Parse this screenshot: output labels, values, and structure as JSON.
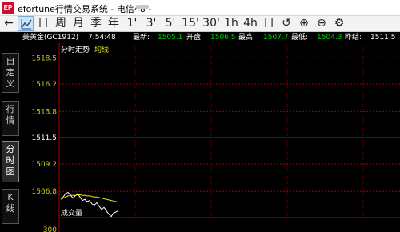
{
  "window": {
    "logo_text": "EP",
    "title": "efortune行情交易系统 - 电信48 -"
  },
  "toolbar": {
    "buttons": [
      {
        "label": "←",
        "icon": "back-arrow-icon"
      },
      {
        "label": "",
        "icon": "trend-line-icon",
        "selected": true
      },
      {
        "label": "日"
      },
      {
        "label": "周"
      },
      {
        "label": "月"
      },
      {
        "label": "季"
      },
      {
        "label": "年"
      },
      {
        "label": "1'"
      },
      {
        "label": "3'"
      },
      {
        "label": "5'"
      },
      {
        "label": "15'"
      },
      {
        "label": "30'"
      },
      {
        "label": "1h"
      },
      {
        "label": "4h"
      },
      {
        "label": "日"
      },
      {
        "label": "↺",
        "icon": "refresh-icon"
      },
      {
        "label": "⊕",
        "icon": "zoom-in-icon"
      },
      {
        "label": "⊖",
        "icon": "zoom-out-icon"
      },
      {
        "label": "⚙",
        "icon": "settings-icon"
      }
    ]
  },
  "sidebar": {
    "tabs": [
      {
        "label": "自定义"
      },
      {
        "label": "行情"
      },
      {
        "label": "分时图",
        "active": true
      },
      {
        "label": "K线"
      }
    ]
  },
  "quote": {
    "name": "美黄金(GC1912)",
    "time": "7:54:48",
    "latest_label": "最新:",
    "latest": "1505.1",
    "open_label": "开盘:",
    "open": "1506.5",
    "high_label": "最高:",
    "high": "1507.7",
    "low_label": "最低:",
    "low": "1504.3",
    "prevclose_label": "昨结:",
    "prevclose": "1511.5"
  },
  "chart_data": {
    "type": "line",
    "title_left": "分时走势",
    "title_right": "均线",
    "volume_label": "成交量",
    "volume_tick": "300",
    "y_ticks": [
      "1518.5",
      "1516.2",
      "1513.8",
      "1511.5",
      "1509.2",
      "1506.8"
    ],
    "ylim": [
      1504.5,
      1519.5
    ],
    "reference_price": 1511.5,
    "colors": {
      "price": "#ffffff",
      "average": "#e6e600",
      "grid": "#b00000",
      "tick": "#d0d000",
      "reference": "#ff2020"
    },
    "series": [
      {
        "values": [
          1506.1,
          1506.3,
          1506.6,
          1506.7,
          1506.5,
          1506.2,
          1506.4,
          1506.6,
          1506.3,
          1506.0,
          1506.1,
          1505.9,
          1506.0,
          1505.7,
          1505.6,
          1505.8,
          1505.5,
          1505.2,
          1505.4,
          1505.1,
          1504.8,
          1504.6,
          1504.9,
          1505.0,
          1505.1
        ]
      },
      {
        "values": [
          1506.1,
          1506.2,
          1506.3,
          1506.4,
          1506.45,
          1506.45,
          1506.45,
          1506.5,
          1506.5,
          1506.45,
          1506.45,
          1506.4,
          1506.4,
          1506.35,
          1506.3,
          1506.3,
          1506.25,
          1506.2,
          1506.15,
          1506.1,
          1506.05,
          1506.0,
          1505.95,
          1505.9,
          1505.85
        ]
      }
    ]
  }
}
